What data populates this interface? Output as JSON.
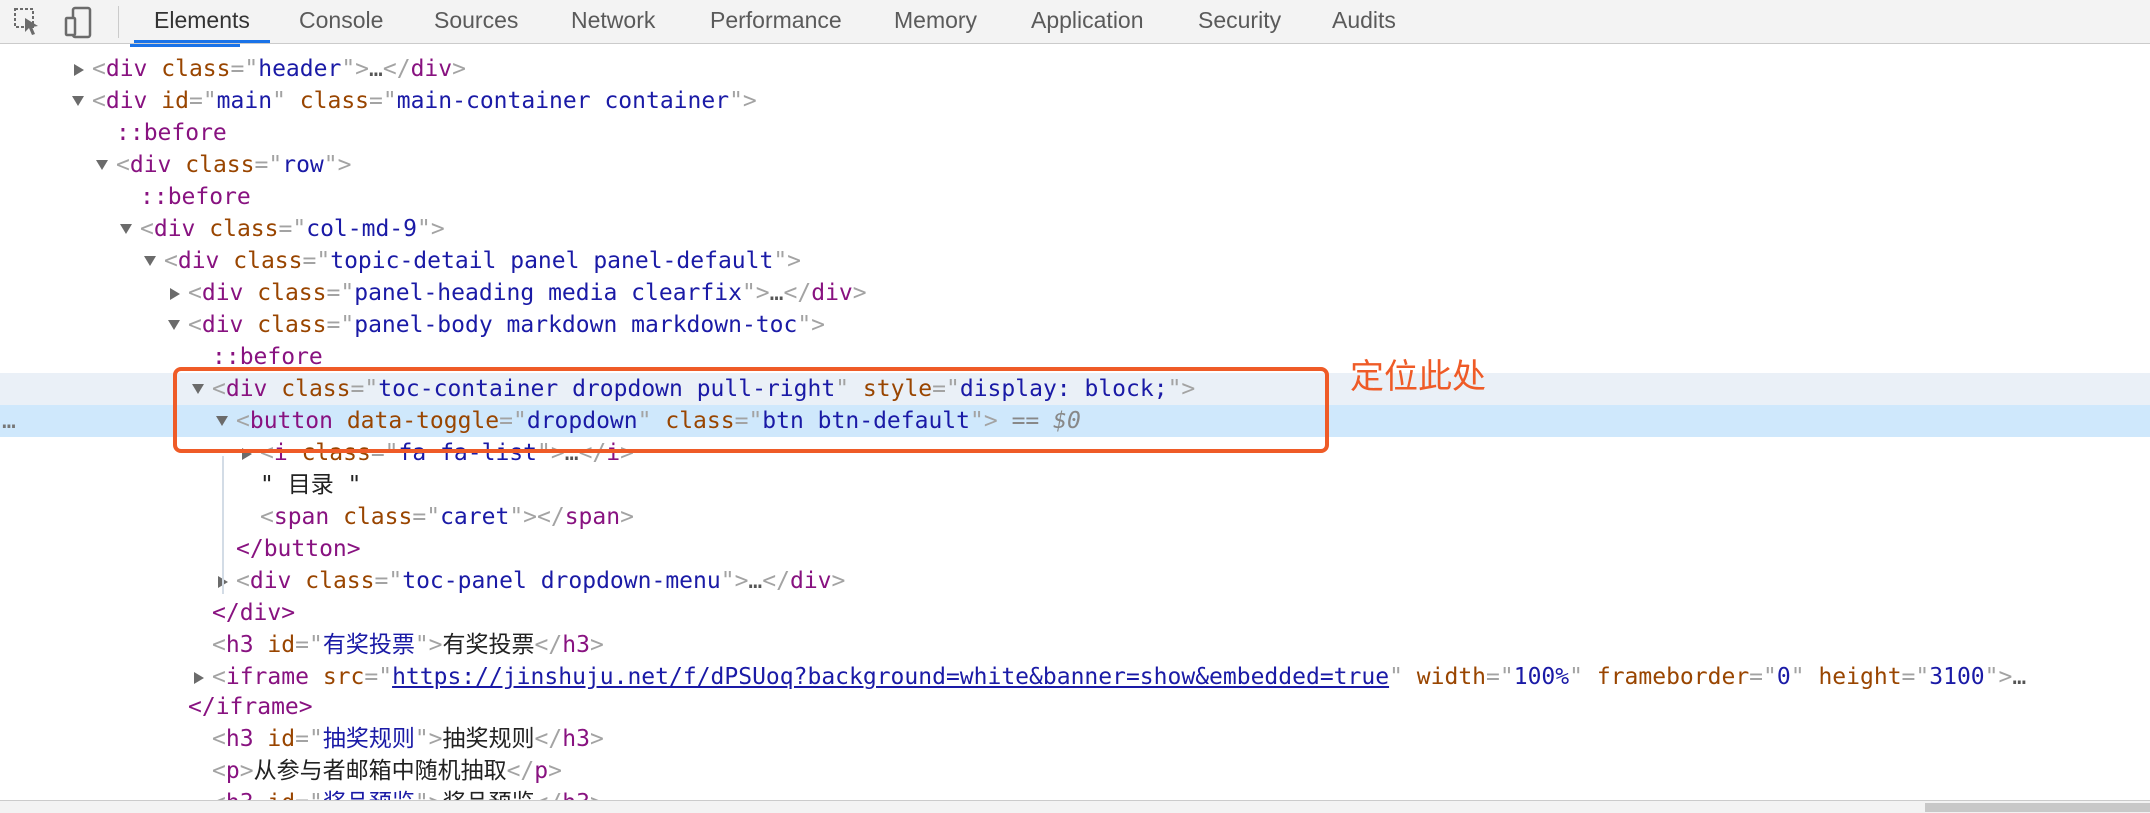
{
  "toolbar": {
    "inspect_icon": "cursor-select-icon",
    "device_icon": "device-toggle-icon",
    "tabs": [
      "Elements",
      "Console",
      "Sources",
      "Network",
      "Performance",
      "Memory",
      "Application",
      "Security",
      "Audits"
    ],
    "active_tab": "Elements"
  },
  "tree": {
    "header_div": {
      "open": "<div class=\"header\">",
      "collapsed": "…</div>"
    },
    "main_div": {
      "tag": "div",
      "id_attr": "id",
      "id_val": "main",
      "class_attr": "class",
      "class_val": "main-container container"
    },
    "before1": "::before",
    "row_div": {
      "class_val": "row"
    },
    "before2": "::before",
    "col_div": {
      "class_val": "col-md-9"
    },
    "topic_div": {
      "class_val": "topic-detail panel panel-default"
    },
    "heading_div": {
      "class_val": "panel-heading media clearfix",
      "tail": "…"
    },
    "body_div": {
      "class_val": "panel-body markdown markdown-toc"
    },
    "before3": "::before",
    "toc_div": {
      "class_val": "toc-container dropdown pull-right",
      "style_attr": "style",
      "style_val": "display: block;"
    },
    "button": {
      "toggle_attr": "data-toggle",
      "toggle_val": "dropdown",
      "class_attr": "class",
      "class_val": "btn btn-default",
      "marker": "== $0"
    },
    "i_tag": {
      "class_val": "fa fa-list",
      "tail": "…"
    },
    "text_node": "\" 目录 \"",
    "span_tag": {
      "class_val": "caret"
    },
    "button_close": "</button>",
    "panel_div": {
      "class_val": "toc-panel dropdown-menu",
      "tail": "…"
    },
    "div_close": "</div>",
    "h3_vote": {
      "id_val": "有奖投票",
      "text": "有奖投票"
    },
    "iframe": {
      "src": "https://jinshuju.net/f/dPSUoq?background=white&banner=show&embedded=true",
      "width_attr": "width",
      "width_val": "100%",
      "frameborder_attr": "frameborder",
      "frameborder_val": "0",
      "height_attr": "height",
      "height_val": "3100",
      "tail": "…"
    },
    "iframe_close": "</iframe>",
    "h3_rules": {
      "id_val": "抽奖规则",
      "text": "抽奖规则"
    },
    "p_text": "从参与者邮箱中随机抽取",
    "h3_prize_partial": {
      "id_val": "奖品预览",
      "text": "奖品预览"
    }
  },
  "annotation": {
    "label": "定位此处",
    "color": "#ef5b27"
  },
  "colors": {
    "tag": "#881280",
    "attr": "#994500",
    "value": "#1a1aa6",
    "selection": "#cfe8fc",
    "accent": "#1a73e8"
  }
}
